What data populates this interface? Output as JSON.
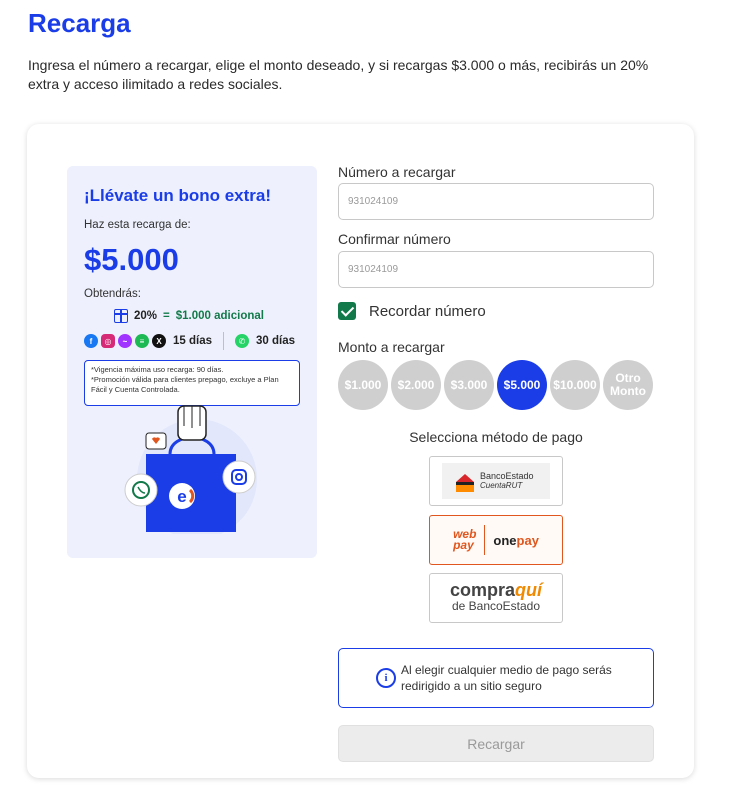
{
  "page": {
    "title": "Recarga",
    "intro": "Ingresa el número a recargar, elige el monto deseado, y si recargas $3.000 o más, recibirás un 20% extra y acceso ilimitado a redes sociales."
  },
  "promo": {
    "title": "¡Llévate un bono extra!",
    "subtitle": "Haz esta recarga de:",
    "amount": "$5.000",
    "get_label": "Obtendrás:",
    "bonus_percent": "20%",
    "bonus_equals": "=",
    "bonus_value": "$1.000 adicional",
    "social_days": "15 días",
    "whatsapp_days": "30 días",
    "fine_print_1": "*Vigencia máxima uso recarga: 90 días.",
    "fine_print_2": "*Promoción válida para clientes prepago, excluye a Plan Fácil y Cuenta Controlada.",
    "icons": [
      "facebook-icon",
      "instagram-icon",
      "messenger-icon",
      "spotify-icon",
      "x-icon",
      "whatsapp-icon"
    ]
  },
  "form": {
    "number_label": "Número a recargar",
    "number_value": "931024109",
    "confirm_label": "Confirmar número",
    "confirm_value": "931024109",
    "remember_label": "Recordar número",
    "remember_checked": true,
    "amount_label": "Monto a recargar",
    "amounts": [
      "$1.000",
      "$2.000",
      "$3.000",
      "$5.000",
      "$10.000",
      "Otro Monto"
    ],
    "selected_amount": "$5.000",
    "method_title": "Selecciona método de pago",
    "methods": {
      "bancoestado_name": "BancoEstado",
      "bancoestado_sub": "CuentaRUT",
      "webpay_1": "web",
      "webpay_2": "pay",
      "onepay_1": "one",
      "onepay_2": "pay",
      "compraqui_1": "compra",
      "compraqui_2": "quí",
      "compraqui_sub": "de BancoEstado"
    },
    "info_text": "Al elegir cualquier medio de pago serás redirigido a un sitio seguro",
    "submit_label": "Recargar"
  },
  "colors": {
    "brand_blue": "#1a3de8",
    "green": "#127a4a",
    "orange": "#e0561e"
  }
}
